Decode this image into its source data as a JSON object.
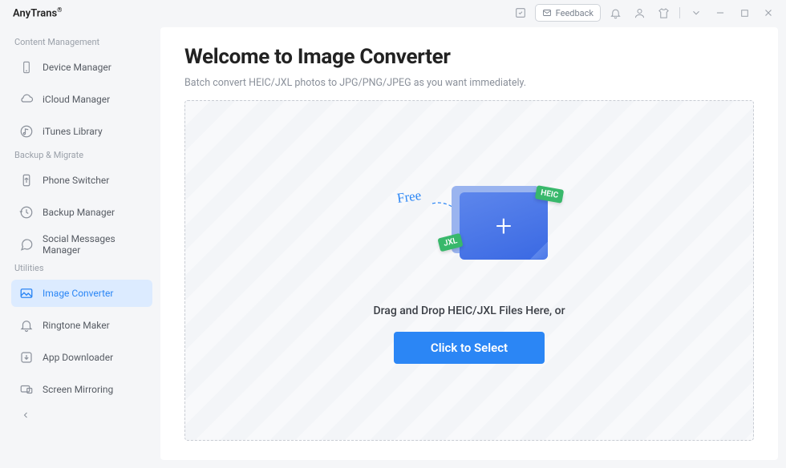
{
  "brand": {
    "name": "AnyTrans",
    "reg": "®"
  },
  "titlebar": {
    "feedback": "Feedback"
  },
  "sidebar": {
    "sections": {
      "content": {
        "label": "Content Management"
      },
      "backup": {
        "label": "Backup & Migrate"
      },
      "utilities": {
        "label": "Utilities"
      }
    },
    "items": {
      "device": "Device Manager",
      "icloud": "iCloud Manager",
      "itunes": "iTunes Library",
      "switcher": "Phone Switcher",
      "backupmgr": "Backup Manager",
      "social": "Social Messages Manager",
      "imgconv": "Image Converter",
      "ringtone": "Ringtone Maker",
      "appdl": "App Downloader",
      "mirror": "Screen Mirroring"
    }
  },
  "main": {
    "title": "Welcome to Image Converter",
    "subtitle": "Batch convert HEIC/JXL photos to JPG/PNG/JPEG as you want immediately.",
    "free_label": "Free",
    "tag_heic": "HEIC",
    "tag_jxl": "JXL",
    "drop_text": "Drag and Drop HEIC/JXL Files Here, or",
    "select_button": "Click to Select"
  }
}
